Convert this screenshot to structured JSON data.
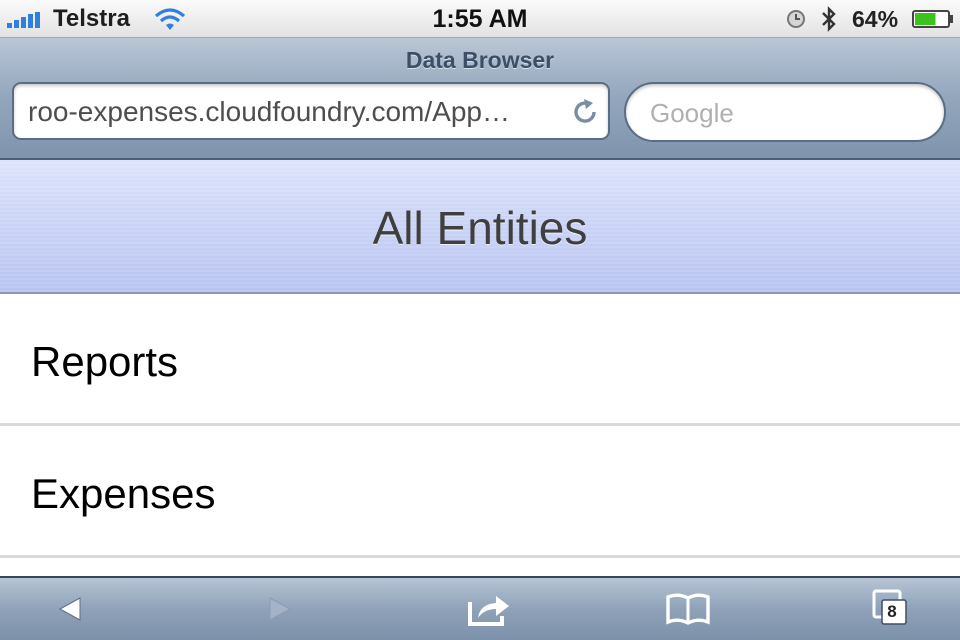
{
  "status_bar": {
    "carrier": "Telstra",
    "time": "1:55 AM",
    "battery_percent": "64%",
    "battery_level": 0.64,
    "icons": [
      "signal-bars-icon",
      "wifi-icon",
      "alarm-clock-icon",
      "bluetooth-icon",
      "battery-icon"
    ]
  },
  "browser": {
    "page_title": "Data Browser",
    "url": "roo-expenses.cloudfoundry.com/App…",
    "search_placeholder": "Google",
    "open_pages_count": "8"
  },
  "page": {
    "header_title": "All Entities",
    "items": [
      {
        "label": "Reports"
      },
      {
        "label": "Expenses"
      }
    ]
  },
  "colors": {
    "header_gradient_top": "#dde3fb",
    "header_gradient_bottom": "#b7c3f1",
    "chrome_blue": "#8fa2b9",
    "battery_green": "#3cc11d",
    "wifi_blue": "#2f7ee0"
  }
}
